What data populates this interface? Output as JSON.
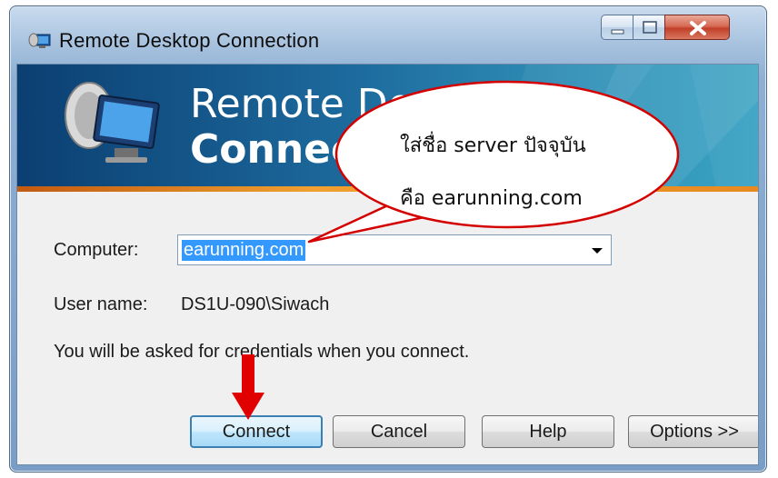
{
  "window": {
    "title": "Remote Desktop Connection",
    "buttons": [
      "minimize",
      "maximize",
      "close"
    ]
  },
  "banner": {
    "title_line1": "Remote Desktop",
    "title_line2": "Connection"
  },
  "form": {
    "computer_label": "Computer:",
    "computer_value": "earunning.com",
    "username_label": "User name:",
    "username_value": "DS1U-090\\Siwach",
    "info_text": "You will be asked for credentials when you connect."
  },
  "buttons": {
    "connect": "Connect",
    "cancel": "Cancel",
    "help": "Help",
    "options": "Options >>"
  },
  "callout": {
    "line1": "ใส่ชื่อ server ปัจจุบัน",
    "line2": "คือ earunning.com"
  },
  "colors": {
    "callout_border": "#d40000",
    "arrow": "#e00000",
    "selection": "#3399ff"
  },
  "icons": [
    "remote-desktop-icon",
    "minimize-icon",
    "maximize-icon",
    "close-icon",
    "dropdown-arrow-icon",
    "red-down-arrow"
  ]
}
